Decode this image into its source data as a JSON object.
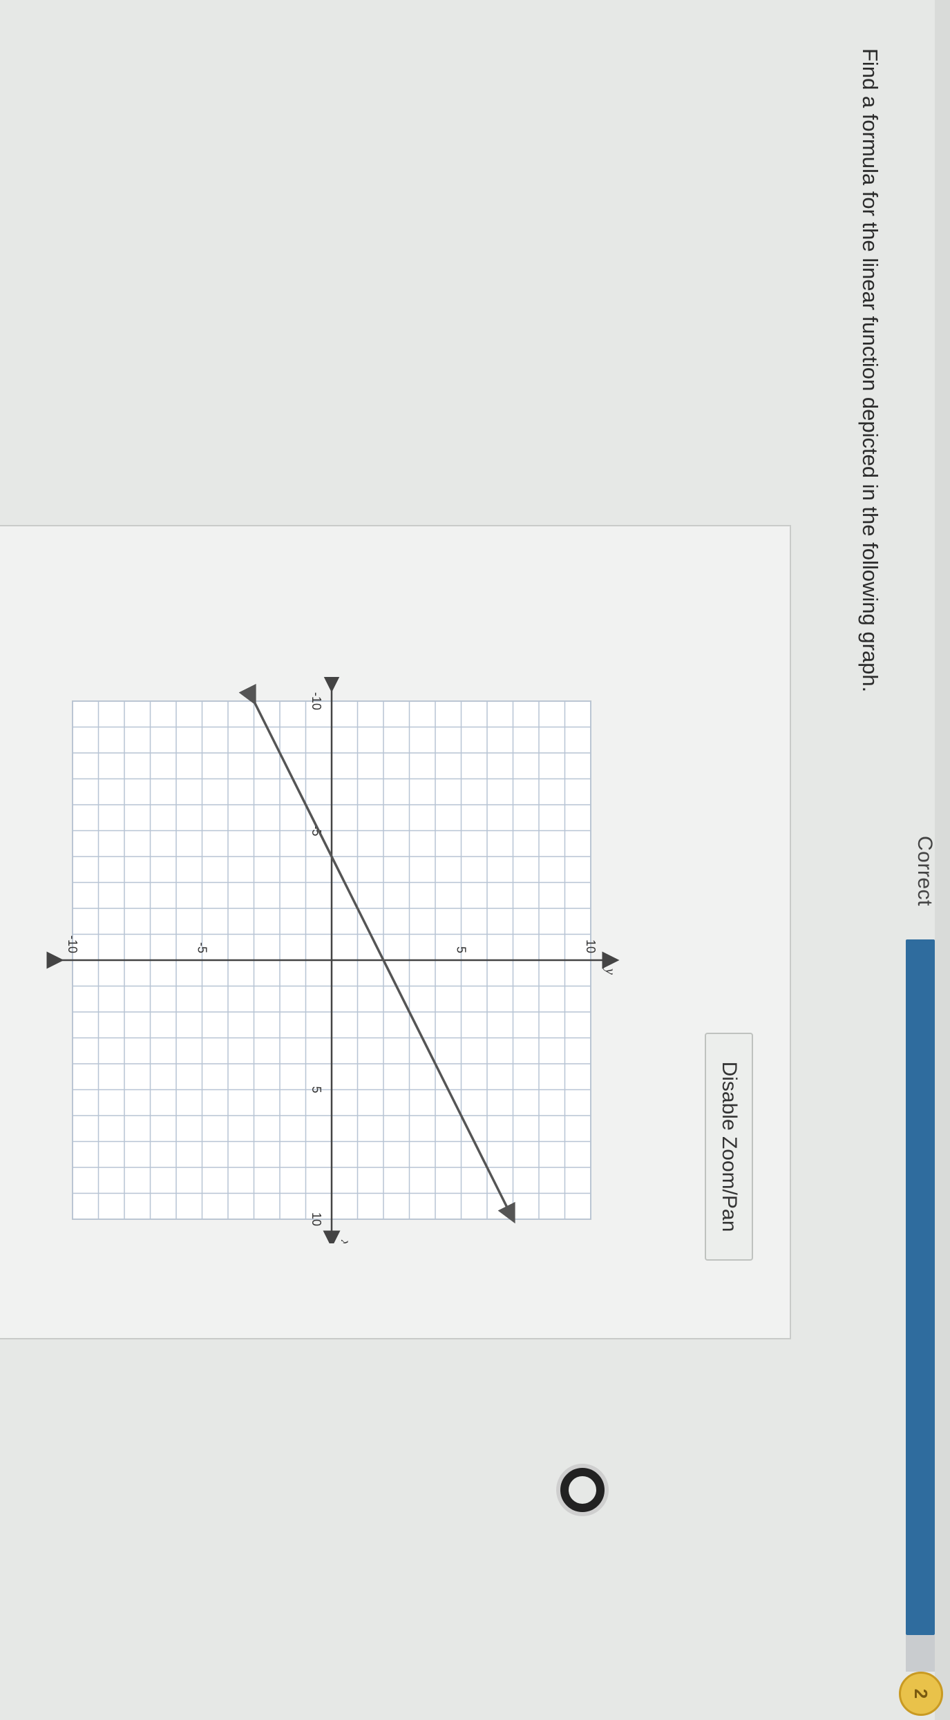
{
  "header": {
    "status_label": "Correct",
    "progress_fraction": 0.95,
    "coin_label": "2",
    "accent_color": "#2f6c9e"
  },
  "question": {
    "prompt": "Find a formula for the linear function depicted in the following graph."
  },
  "controls": {
    "zoom_button_label": "Disable Zoom/Pan"
  },
  "chart_data": {
    "type": "line",
    "title": "",
    "xlabel": "x",
    "ylabel": "y",
    "xlim": [
      -10,
      10
    ],
    "ylim": [
      -10,
      10
    ],
    "grid": true,
    "x_ticks": [
      "-10",
      "-5",
      "5",
      "10"
    ],
    "y_ticks": [
      "-10",
      "-5",
      "5",
      "10"
    ],
    "series": [
      {
        "x": [
          -10,
          10
        ],
        "y": [
          -3,
          7
        ],
        "color": "#555555"
      }
    ]
  },
  "icons": {
    "loader": "loading-spinner-icon",
    "coin": "coin-icon"
  }
}
